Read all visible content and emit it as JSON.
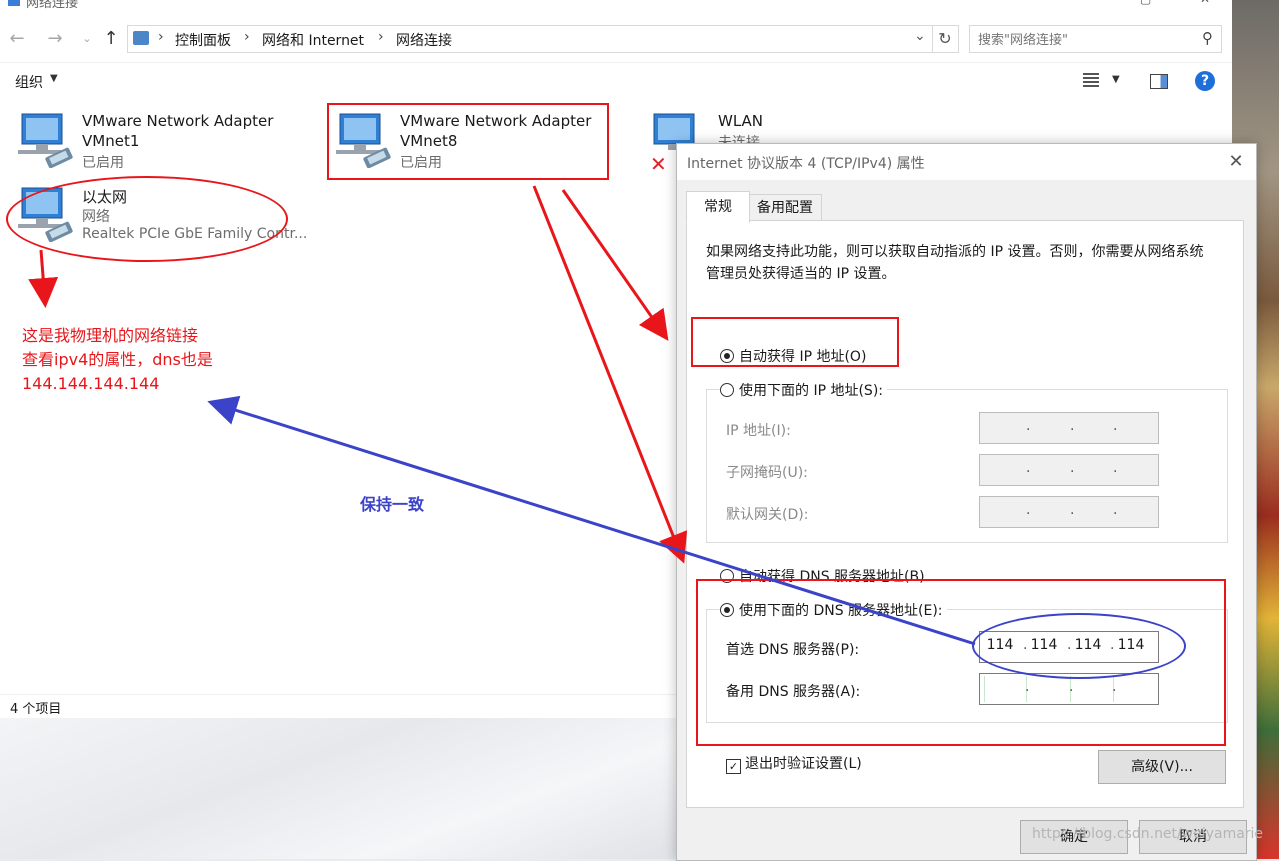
{
  "explorer": {
    "window_title": "网络连接",
    "breadcrumbs": [
      "控制面板",
      "网络和 Internet",
      "网络连接"
    ],
    "search_placeholder": "搜索\"网络连接\"",
    "organize_label": "组织",
    "help_label": "?",
    "status_count": "4 个项目",
    "items": [
      {
        "line1": "VMware Network Adapter",
        "line2": "VMnet1",
        "status": "已启用"
      },
      {
        "line1": "VMware Network Adapter",
        "line2": "VMnet8",
        "status": "已启用"
      },
      {
        "line1": "WLAN",
        "line2": "未连接",
        "status": ""
      },
      {
        "line1": "以太网",
        "line2": "网络",
        "status": "Realtek PCIe GbE Family Contr..."
      }
    ]
  },
  "annotations": {
    "note_lines": [
      "这是我物理机的网络链接",
      "查看ipv4的属性，dns也是",
      "144.144.144.144"
    ],
    "keep_consistent": "保持一致",
    "red_color": "#e8161a",
    "blue_color": "#3b43c9"
  },
  "dialog": {
    "title": "Internet 协议版本 4 (TCP/IPv4) 属性",
    "tabs": [
      "常规",
      "备用配置"
    ],
    "description": "如果网络支持此功能，则可以获取自动指派的 IP 设置。否则，你需要从网络系统管理员处获得适当的 IP 设置。",
    "auto_ip": "自动获得 IP 地址(O)",
    "manual_ip": "使用下面的 IP 地址(S):",
    "ip_label": "IP 地址(I):",
    "mask_label": "子网掩码(U):",
    "gateway_label": "默认网关(D):",
    "auto_dns": "自动获得 DNS 服务器地址(B)",
    "manual_dns": "使用下面的 DNS 服务器地址(E):",
    "preferred_dns_label": "首选 DNS 服务器(P):",
    "preferred_dns": [
      "114",
      "114",
      "114",
      "114"
    ],
    "alternate_dns_label": "备用 DNS 服务器(A):",
    "validate_label": "退出时验证设置(L)",
    "advanced_label": "高级(V)...",
    "ok_label": "确定",
    "cancel_label": "取消"
  },
  "watermark": "https://blog.csdn.net/weiyamarie"
}
